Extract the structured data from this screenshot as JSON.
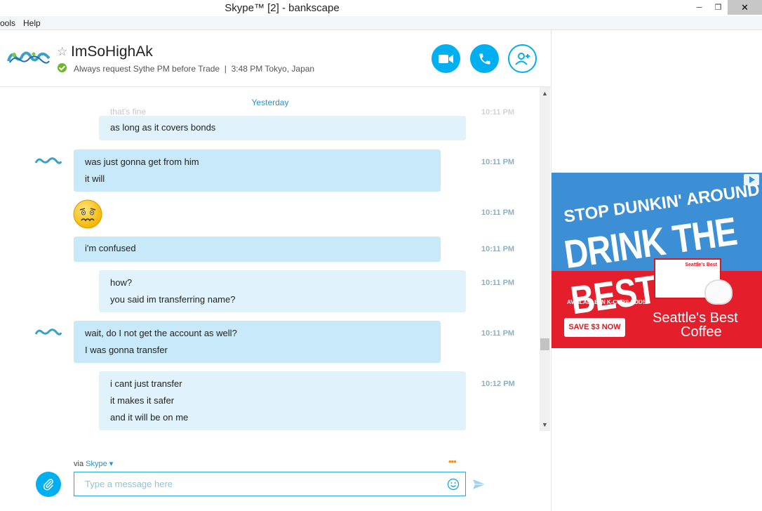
{
  "window": {
    "title": "Skype™ [2] - bankscape",
    "min_glyph": "─",
    "max_glyph": "❐",
    "close_glyph": "✕"
  },
  "menu": {
    "tools": "ools",
    "help": "Help"
  },
  "header": {
    "contact_name": "ImSoHighAk",
    "favorite_glyph": "☆",
    "mood": "Always request Sythe PM before Trade",
    "separator": "|",
    "local_time": "3:48 PM Tokyo, Japan"
  },
  "chat": {
    "day_separator": "Yesterday",
    "faded_message": "that's fine",
    "faded_time": "10:11 PM",
    "messages": [
      {
        "lines": [
          "as long as it covers bonds"
        ],
        "time": ""
      },
      {
        "lines": [
          "was just gonna get from him",
          "it will"
        ],
        "time": "10:11 PM"
      },
      {
        "lines": [],
        "time": "10:11 PM"
      },
      {
        "lines": [
          "i'm confused"
        ],
        "time": "10:11 PM"
      },
      {
        "lines": [
          "how?",
          "you said im transferring name?"
        ],
        "time": "10:11 PM"
      },
      {
        "lines": [
          "wait, do I not get the account as well?",
          "I was gonna transfer"
        ],
        "time": "10:11 PM"
      },
      {
        "lines": [
          "i cant just transfer",
          "it makes it safer",
          "and it will be on me"
        ],
        "time": "10:12 PM"
      }
    ]
  },
  "compose": {
    "via_label": "via",
    "via_service": "Skype",
    "placeholder": "Type a message here",
    "typing_indicator": "•••"
  },
  "ad": {
    "headline1": "STOP DUNKIN' AROUND",
    "headline2": "DRINK THE BEST",
    "availability": "AVAILABLE IN K-CUP® PODS",
    "cta": "SAVE $3 NOW",
    "brand_line1": "Seattle's Best",
    "brand_line2": "Coffee",
    "box_label": "Seattle's Best"
  },
  "colors": {
    "skype_blue": "#00aff0",
    "incoming_bubble": "#c7e9f9",
    "outgoing_bubble": "#e0f3fc",
    "online_green": "#6cb52d",
    "ad_red": "#e41e2b"
  }
}
